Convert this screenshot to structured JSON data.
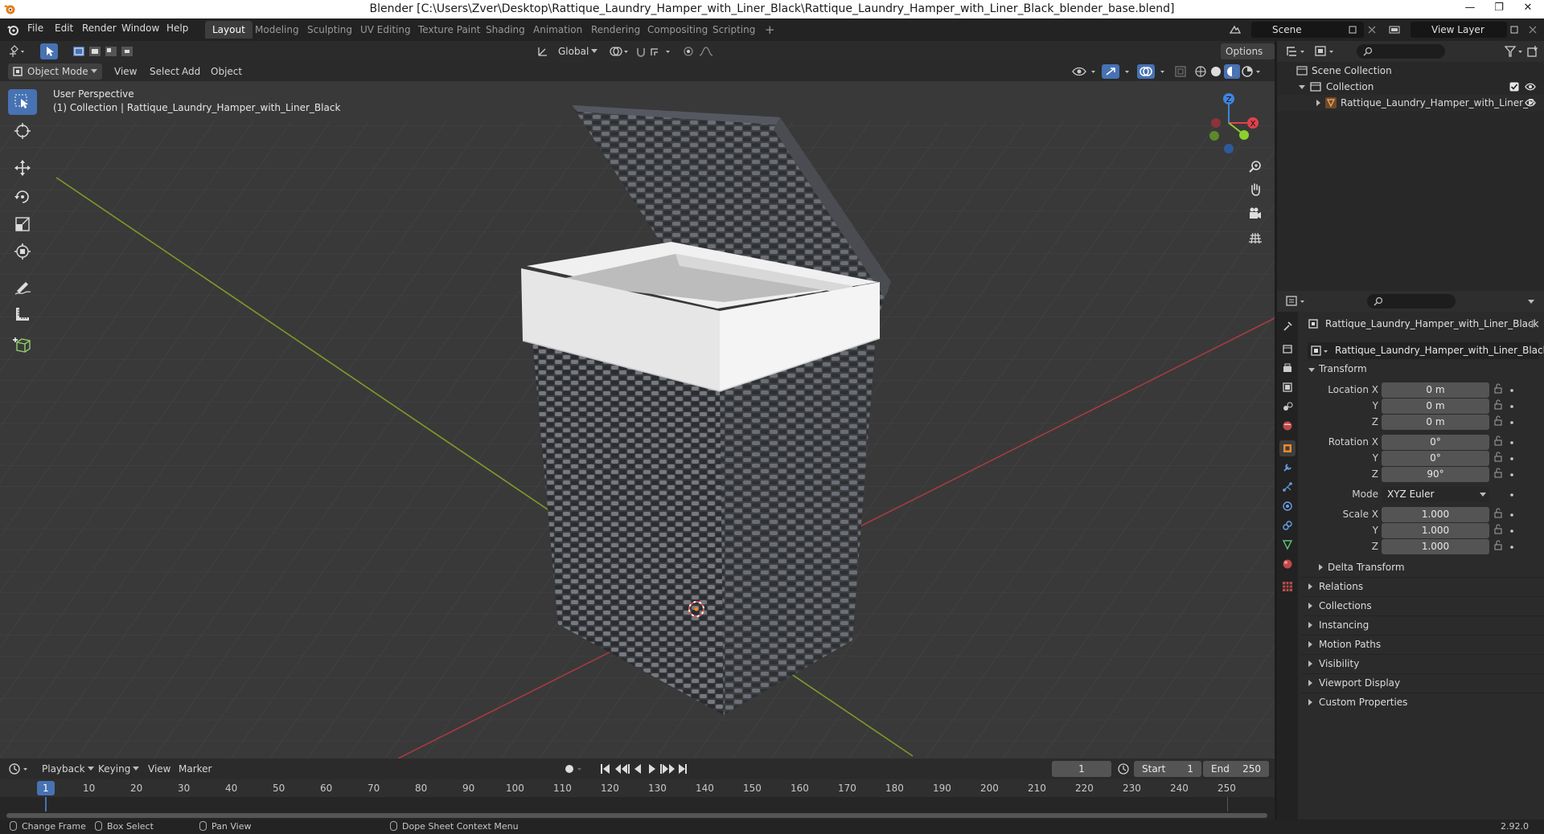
{
  "window": {
    "title": "Blender [C:\\Users\\Zver\\Desktop\\Rattique_Laundry_Hamper_with_Liner_Black\\Rattique_Laundry_Hamper_with_Liner_Black_blender_base.blend]",
    "minimize": "—",
    "maximize": "❐",
    "close": "✕"
  },
  "menu": [
    "File",
    "Edit",
    "Render",
    "Window",
    "Help"
  ],
  "workspaces": [
    "Layout",
    "Modeling",
    "Sculpting",
    "UV Editing",
    "Texture Paint",
    "Shading",
    "Animation",
    "Rendering",
    "Compositing",
    "Scripting"
  ],
  "active_workspace": "Layout",
  "add_workspace": "+",
  "scene": {
    "name": "Scene",
    "view_layer": "View Layer"
  },
  "viewport": {
    "mode": "Object Mode",
    "menus": [
      "View",
      "Select",
      "Add",
      "Object"
    ],
    "orientation": "Global",
    "options": "Options",
    "perspective_label": "User Perspective",
    "collection_label": "(1) Collection | Rattique_Laundry_Hamper_with_Liner_Black",
    "gizmo_axes": {
      "x": "X",
      "y": "Y",
      "z": "Z"
    }
  },
  "outliner": {
    "scene_collection": "Scene Collection",
    "collection": "Collection",
    "object": "Rattique_Laundry_Hamper_with_Liner_B"
  },
  "properties": {
    "object_name": "Rattique_Laundry_Hamper_with_Liner_Black",
    "data_name": "Rattique_Laundry_Hamper_with_Liner_Black",
    "transform_title": "Transform",
    "location_label": "Location X",
    "rotation_label": "Rotation X",
    "scale_label": "Scale X",
    "axis_y": "Y",
    "axis_z": "Z",
    "location": [
      "0 m",
      "0 m",
      "0 m"
    ],
    "rotation": [
      "0°",
      "0°",
      "90°"
    ],
    "mode_label": "Mode",
    "mode_value": "XYZ Euler",
    "scale": [
      "1.000",
      "1.000",
      "1.000"
    ],
    "delta_transform": "Delta Transform",
    "panels": [
      "Relations",
      "Collections",
      "Instancing",
      "Motion Paths",
      "Visibility",
      "Viewport Display",
      "Custom Properties"
    ]
  },
  "timeline": {
    "menus": [
      "Playback",
      "Keying",
      "View",
      "Marker"
    ],
    "current_frame": "1",
    "start_label": "Start",
    "start": "1",
    "end_label": "End",
    "end": "250",
    "ruler": [
      "1",
      "10",
      "20",
      "30",
      "40",
      "50",
      "60",
      "70",
      "80",
      "90",
      "100",
      "110",
      "120",
      "130",
      "140",
      "150",
      "160",
      "170",
      "180",
      "190",
      "200",
      "210",
      "220",
      "230",
      "240",
      "250"
    ]
  },
  "statusbar": {
    "change_frame": "Change Frame",
    "box_select": "Box Select",
    "pan_view": "Pan View",
    "context_menu": "Dope Sheet Context Menu",
    "version": "2.92.0"
  },
  "colors": {
    "accent": "#4772b3",
    "axis_x": "#e0424c",
    "axis_y": "#8bd12d",
    "axis_z": "#3f84e0",
    "object_orange": "#e88a2b"
  }
}
